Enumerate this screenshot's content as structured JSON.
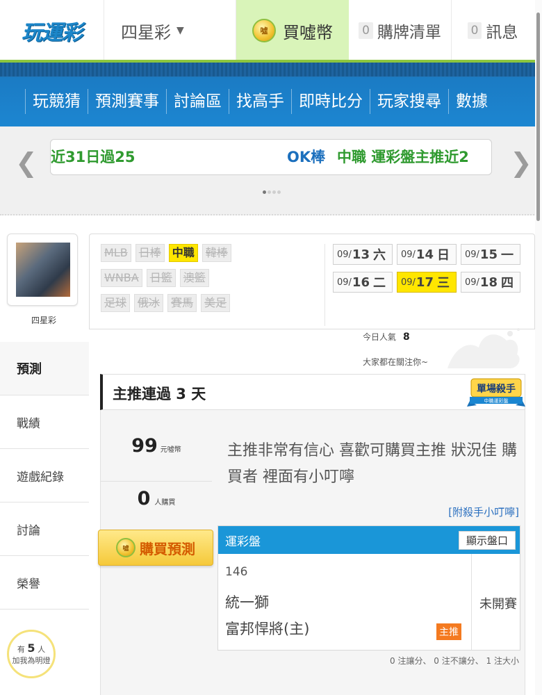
{
  "header": {
    "logo": "玩運彩",
    "game_select": "四星彩",
    "buy_coin_label": "買噓幣",
    "coin_glyph": "噓",
    "cart_count": "0",
    "cart_label": "購牌清單",
    "message_count": "0",
    "message_label": "訊息"
  },
  "nav": {
    "items": [
      {
        "label": "玩競猜"
      },
      {
        "label": "預測賽事"
      },
      {
        "label": "討論區"
      },
      {
        "label": "找高手"
      },
      {
        "label": "即時比分"
      },
      {
        "label": "玩家搜尋"
      },
      {
        "label": "數據"
      }
    ]
  },
  "ticker": {
    "text_left": "近31日過25",
    "text_mid": "OK棒",
    "text_right": "中職  運彩盤主推近2"
  },
  "profile": {
    "name": "四星彩"
  },
  "sidebar": {
    "items": [
      {
        "label": "預測",
        "active": true
      },
      {
        "label": "戰績"
      },
      {
        "label": "遊戲紀錄"
      },
      {
        "label": "討論"
      },
      {
        "label": "榮譽"
      }
    ],
    "lamp_prefix": "有",
    "lamp_count": "5",
    "lamp_suffix": "人",
    "lamp_sub": "加我為明燈"
  },
  "leagues": {
    "row1": [
      "MLB",
      "日棒",
      "中職",
      "韓棒"
    ],
    "row2": [
      "WNBA",
      "日籃",
      "澳籃"
    ],
    "row3": [
      "足球",
      "俄冰",
      "賽馬",
      "美足"
    ],
    "active": "中職"
  },
  "dates": [
    {
      "month": "09/",
      "day": "13",
      "weekday": "六"
    },
    {
      "month": "09/",
      "day": "14",
      "weekday": "日"
    },
    {
      "month": "09/",
      "day": "15",
      "weekday": "一"
    },
    {
      "month": "09/",
      "day": "16",
      "weekday": "二"
    },
    {
      "month": "09/",
      "day": "17",
      "weekday": "三",
      "selected": true
    },
    {
      "month": "09/",
      "day": "18",
      "weekday": "四"
    }
  ],
  "popularity": {
    "label": "今日人氣",
    "value": "8",
    "sub": "大家都在關注你~"
  },
  "card": {
    "streak_title": "主推連過 3 天",
    "badge_main": "單場殺手",
    "badge_sub": "中職運彩盤",
    "price": "99",
    "price_unit": "元噓幣",
    "buyers": "0",
    "buyers_unit": "人購買",
    "description": "主推非常有信心 喜歡可購買主推 狀況佳 購買者 裡面有小叮嚀",
    "tip_link": "[附殺手小叮嚀]",
    "buy_button": "購買預測"
  },
  "pick": {
    "market": "運彩盤",
    "show_odds": "顯示盤口",
    "game_no": "146",
    "team_away": "統一獅",
    "team_home": "富邦悍將(主)",
    "tag": "主推",
    "status": "未開賽",
    "stats": "0 注讓分、 0 注不讓分、 1 注大小"
  },
  "colors": {
    "nav_blue": "#1c86d1",
    "accent_green": "#8cc63f",
    "highlight_yellow": "#ffe600",
    "pick_header_blue": "#1a96d8",
    "tag_orange": "#f47a20"
  }
}
